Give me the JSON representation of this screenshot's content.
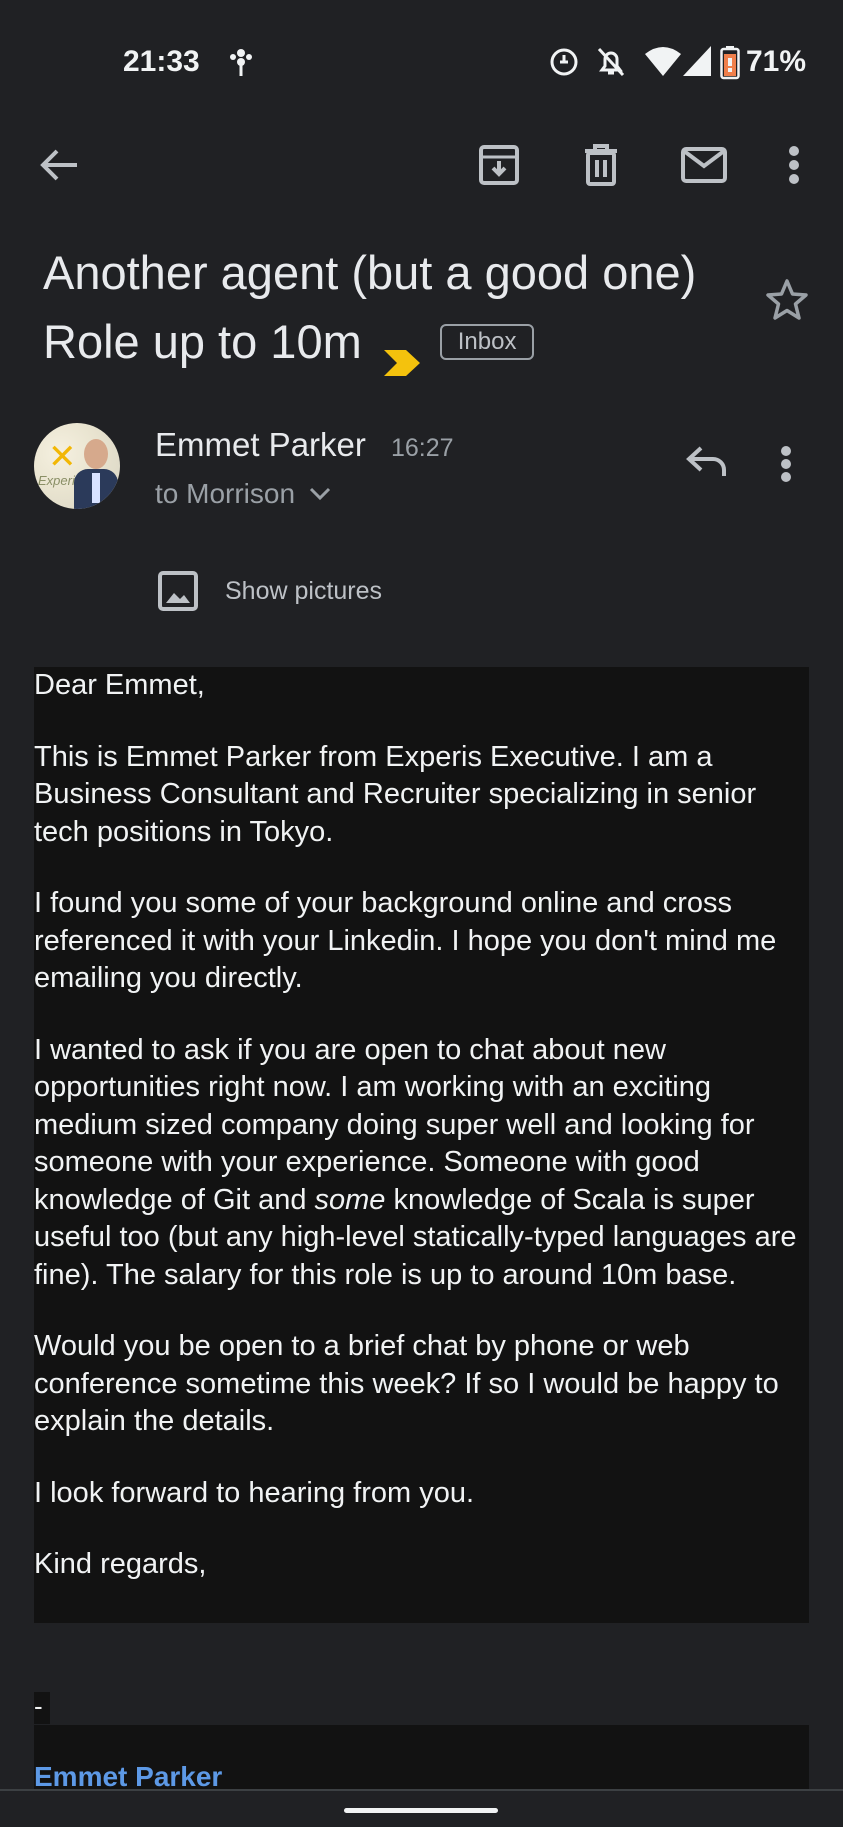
{
  "status_bar": {
    "time": "21:33",
    "battery": "71%",
    "icons": [
      "bug-icon",
      "sync-icon",
      "bell-off-icon",
      "wifi-icon",
      "signal-icon",
      "battery-icon"
    ]
  },
  "toolbar": {
    "icons": [
      "back-arrow-icon",
      "archive-icon",
      "delete-icon",
      "mark-unread-icon",
      "more-vert-icon"
    ]
  },
  "message": {
    "subject_line1": "Another agent (but a good one)",
    "subject_line2": "Role up to 10m",
    "label": "Inbox",
    "sender_name": "Emmet Parker",
    "time": "16:27",
    "recipient": "to Morrison",
    "show_pictures": "Show pictures"
  },
  "body": {
    "greeting": "Dear Emmet,",
    "p1": "This is Emmet Parker from Experis Executive. I am a Business Consultant and Recruiter specializing in senior tech positions in Tokyo.",
    "p2": "I found you some of your background online and cross referenced it with your Linkedin. I hope you don't mind me emailing you directly.",
    "p3_before": "I wanted to ask if you are open to chat about new opportunities right now. I am working with an exciting medium sized company doing super well and looking for someone with your experience. Someone with good knowledge of Git and ",
    "p3_em": "some",
    "p3_after": " knowledge of Scala is super useful too (but any high-level statically-typed languages are fine). The salary for this role is up to around 10m base.",
    "p4": "Would you be open to a brief chat by phone or web conference sometime this week? If so I would be happy to explain the details.",
    "p5": "I look forward to hearing from you.",
    "closing": "Kind regards,",
    "sig_sep": "--",
    "sig_name": "Emmet Parker"
  },
  "colors": {
    "background": "#202124",
    "body_bg": "#121212",
    "link": "#5d99e6",
    "importance": "#f4c20d"
  }
}
